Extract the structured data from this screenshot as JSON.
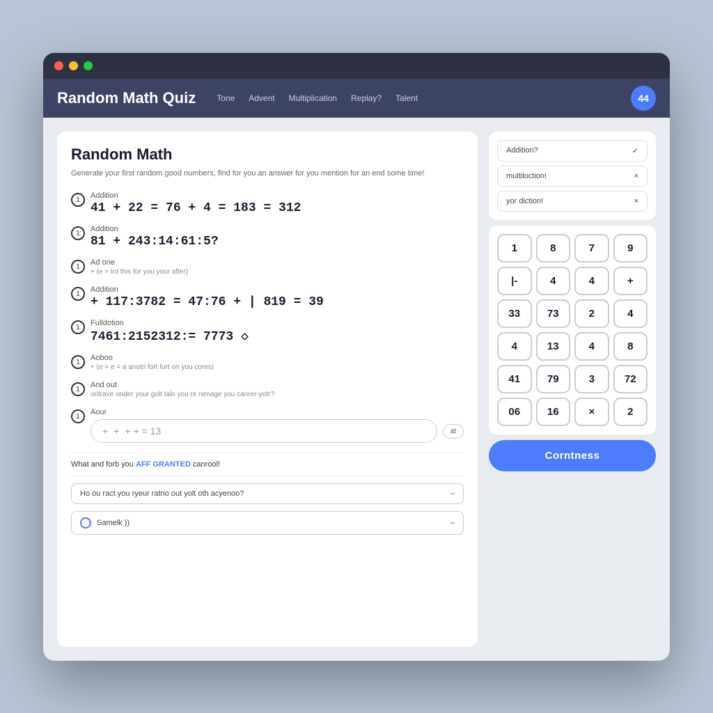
{
  "browser": {
    "title": "Random Math Quiz"
  },
  "navbar": {
    "title": "Random Math Quiz",
    "links": [
      "Tone",
      "Advent",
      "Multiplication",
      "Replay?",
      "Talent"
    ],
    "avatar_label": "44"
  },
  "quiz": {
    "title": "Random Math",
    "description": "Generate your first random good numbers, find for you an answer for you mention for an end some time!",
    "questions": [
      {
        "number": "1",
        "label": "Addition",
        "equation": "41 + 22 = 76 + 4 = 183 = 312",
        "subtext": ""
      },
      {
        "number": "1",
        "label": "Addition",
        "equation": "81 + 243:14:61:5?",
        "subtext": ""
      },
      {
        "number": "1",
        "label": "Ad one",
        "equation": "",
        "subtext": "+ (e = Int this for you your after)"
      },
      {
        "number": "1",
        "label": "Addition",
        "equation": "+ 117:3782 = 47:76 + | 819 = 39",
        "subtext": ""
      },
      {
        "number": "1",
        "label": "Fulldotion",
        "equation": "7461:2152312:= 7773 ◇",
        "subtext": ""
      },
      {
        "number": "1",
        "label": "Aoboo",
        "equation": "",
        "subtext": "+ (e = e = a anotri fort fort on you cores)"
      },
      {
        "number": "1",
        "label": "And out",
        "equation": "",
        "subtext": "oritrave onder your golt talo you re nenage you canrer-yotr?"
      }
    ],
    "answer_label": "Aour",
    "answer_placeholder": "+ +  = 13",
    "answer_submit": "at",
    "status_text": "What and forb you ",
    "status_highlight": "AFF GRANTED",
    "status_suffix": " canrool!",
    "dropdown1_placeholder": "Ho ou ract you ryeur ratno out yolt oth acyenoo?",
    "dropdown2_placeholder": "Samelk ))"
  },
  "filters": [
    {
      "label": "Addition?",
      "icon": "check"
    },
    {
      "label": "multiloction!",
      "icon": "cross"
    },
    {
      "label": "yor diction!",
      "icon": "cross"
    }
  ],
  "numpad": {
    "buttons": [
      "1",
      "8",
      "7",
      "9",
      "|-",
      "4",
      "4",
      "+",
      "33",
      "73",
      "2",
      "4",
      "4",
      "13",
      "4",
      "8",
      "41",
      "79",
      "3",
      "72",
      "06",
      "16",
      "×",
      "2"
    ]
  },
  "confirm_button_label": "Corntness"
}
